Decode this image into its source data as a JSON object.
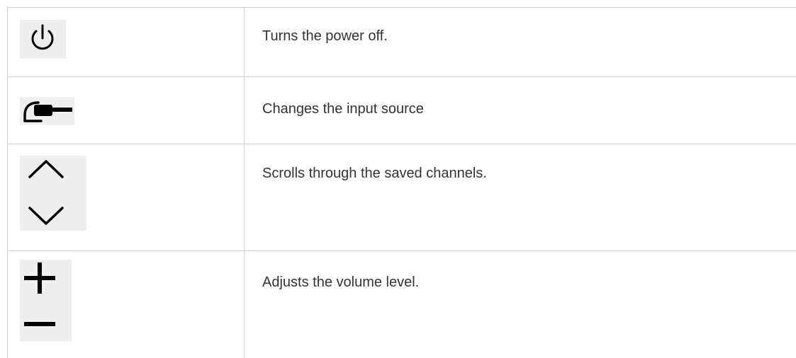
{
  "rows": [
    {
      "icon": "power-icon",
      "description": "Turns the power off."
    },
    {
      "icon": "input-source-icon",
      "description": "Changes the input source"
    },
    {
      "icon": "channel-up-down-icon",
      "description": "Scrolls through the saved channels."
    },
    {
      "icon": "volume-plus-minus-icon",
      "description": "Adjusts the volume level."
    }
  ],
  "colors": {
    "border": "#d2d2d2",
    "icon_background": "#efefef",
    "icon_stroke": "#000000",
    "text": "#333333"
  }
}
